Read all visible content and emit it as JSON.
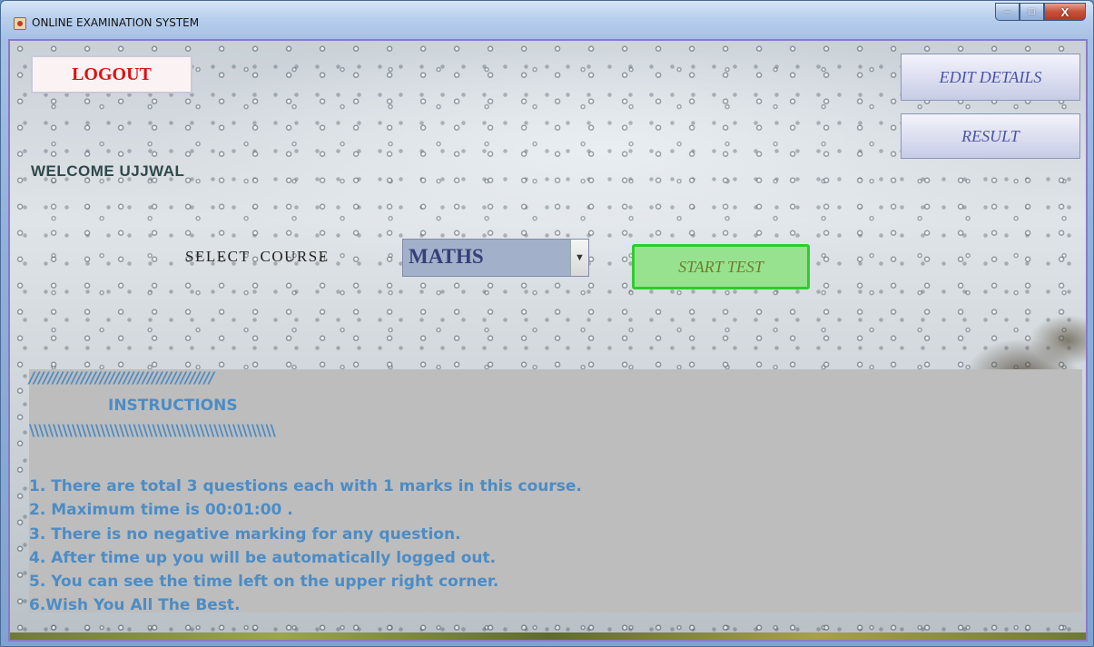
{
  "window": {
    "title": "ONLINE EXAMINATION SYSTEM",
    "controls": {
      "minimize": "–",
      "maximize": "□",
      "close": "X"
    }
  },
  "header": {
    "logout_label": "LOGOUT",
    "edit_details_label": "EDIT DETAILS",
    "result_label": "RESULT",
    "welcome_text": "WELCOME UJJWAL"
  },
  "course": {
    "label": "SELECT  COURSE",
    "selected": "MATHS",
    "start_label": "START TEST"
  },
  "instructions": {
    "slashes_top": "///////////////////////////////////////",
    "heading": "INSTRUCTIONS",
    "slashes_bottom": "\\\\\\\\\\\\\\\\\\\\\\\\\\\\\\\\\\\\\\\\\\\\\\\\\\\\\\\\\\\\\\\\\\\\\\\\\\\\\\\\\\\\\\\\\\\\\\\\\\\\\\\\",
    "items": [
      "1. There are total 3 questions each with 1 marks in this course.",
      "2. Maximum time is 00:01:00 .",
      "3. There is no negative marking for any question.",
      "4. After time up you will be automatically logged out.",
      "5. You can see the time left on the upper right corner.",
      "6.Wish You All The Best."
    ]
  }
}
